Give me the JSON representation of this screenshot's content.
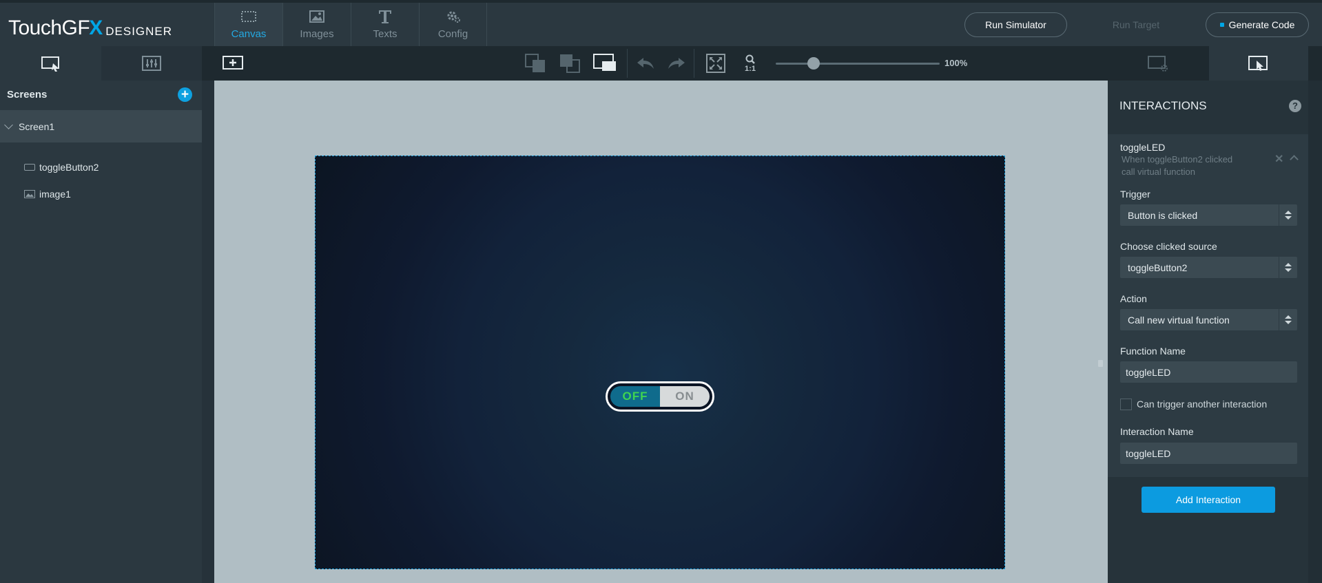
{
  "app": {
    "logo_main": "TouchGF",
    "logo_x": "X",
    "logo_sub": "DESIGNER"
  },
  "nav": {
    "tabs": [
      {
        "label": "Canvas",
        "active": true
      },
      {
        "label": "Images",
        "active": false
      },
      {
        "label": "Texts",
        "active": false
      },
      {
        "label": "Config",
        "active": false
      }
    ]
  },
  "topbar": {
    "run_simulator": "Run Simulator",
    "run_target": "Run Target",
    "generate_code": "Generate Code"
  },
  "toolbar": {
    "zoom_level": "100%",
    "zoom_reset": "1:1",
    "zoom_value": 100
  },
  "screens_panel": {
    "title": "Screens",
    "screen": "Screen1",
    "widgets": [
      "toggleButton2",
      "image1"
    ]
  },
  "canvas": {
    "toggle_off": "OFF",
    "toggle_on": "ON"
  },
  "interactions": {
    "title": "INTERACTIONS",
    "help": "?",
    "item": {
      "name": "toggleLED",
      "desc_line1": "When toggleButton2 clicked",
      "desc_line2": "call virtual function"
    },
    "trigger_label": "Trigger",
    "trigger_value": "Button is clicked",
    "source_label": "Choose clicked source",
    "source_value": "toggleButton2",
    "action_label": "Action",
    "action_value": "Call new virtual function",
    "function_label": "Function Name",
    "function_value": "toggleLED",
    "can_trigger_label": "Can trigger another interaction",
    "interaction_name_label": "Interaction Name",
    "interaction_name_value": "toggleLED",
    "add_button": "Add Interaction"
  },
  "colors": {
    "accent": "#0c9be0",
    "toggle_off_text": "#3fd451"
  }
}
